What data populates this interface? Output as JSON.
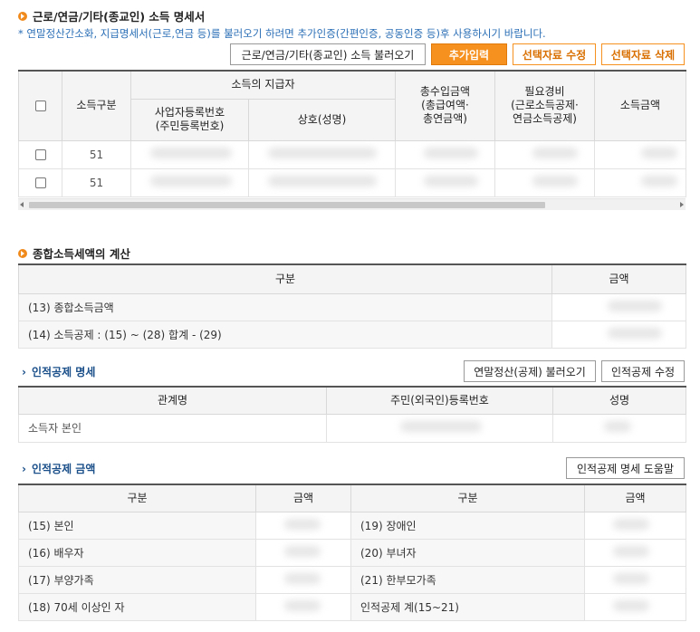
{
  "section1": {
    "title": "근로/연금/기타(종교인) 소득 명세서",
    "note": "* 연말정산간소화, 지급명세서(근로,연금 등)를 불러오기 하려면 추가인증(간편인증, 공동인증 등)후 사용하시기 바랍니다.",
    "buttons": {
      "load": "근로/연금/기타(종교인) 소득 불러오기",
      "add": "추가입력",
      "edit": "선택자료 수정",
      "delete": "선택자료 삭제"
    },
    "table": {
      "col_income_type": "소득구분",
      "col_payer_group": "소득의 지급자",
      "col_biz_no": "사업자등록번호\n(주민등록번호)",
      "col_company": "상호(성명)",
      "col_total": "총수입금액\n(총급여액·\n총연금액)",
      "col_expense": "필요경비\n(근로소득공제·\n연금소득공제)",
      "col_income": "소득금액",
      "rows": [
        {
          "type": "51"
        },
        {
          "type": "51"
        }
      ]
    }
  },
  "section2": {
    "title": "종합소득세액의 계산",
    "table": {
      "col_category": "구분",
      "col_amount": "금액",
      "rows": [
        {
          "label": "(13) 종합소득금액"
        },
        {
          "label": "(14) 소득공제 : (15) ~ (28) 합계 - (29)"
        }
      ]
    }
  },
  "section3": {
    "title": "인적공제 명세",
    "buttons": {
      "load": "연말정산(공제) 불러오기",
      "edit": "인적공제 수정"
    },
    "table": {
      "col_relation": "관계명",
      "col_id": "주민(외국인)등록번호",
      "col_name": "성명",
      "rows": [
        {
          "relation": "소득자 본인"
        }
      ]
    }
  },
  "section4": {
    "title": "인적공제 금액",
    "buttons": {
      "help": "인적공제 명세 도움말"
    },
    "table": {
      "col_category_l": "구분",
      "col_amount_l": "금액",
      "col_category_r": "구분",
      "col_amount_r": "금액",
      "rows": [
        {
          "left": "(15) 본인",
          "right": "(19) 장애인"
        },
        {
          "left": "(16) 배우자",
          "right": "(20) 부녀자"
        },
        {
          "left": "(17) 부양가족",
          "right": "(21) 한부모가족"
        },
        {
          "left": "(18) 70세 이상인 자",
          "right": "인적공제 계(15~21)"
        }
      ]
    }
  },
  "colors": {
    "accent": "#f6901e",
    "link_blue": "#1a4f8a",
    "note_blue": "#2b6fb6"
  }
}
